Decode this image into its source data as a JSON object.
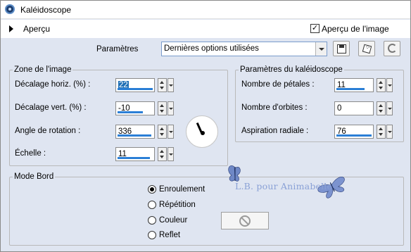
{
  "window": {
    "title": "Kaléidoscope"
  },
  "toolbar": {
    "apercu_label": "Aperçu",
    "preview_label": "Aperçu de l'image",
    "preview_checked": true,
    "params_label": "Paramètres",
    "preset_value": "Dernières options utilisées"
  },
  "zone": {
    "title": "Zone de l'image",
    "fields": [
      {
        "label": "Décalage horiz. (%) :",
        "value": "22"
      },
      {
        "label": "Décalage vert. (%) :",
        "value": "-10"
      },
      {
        "label": "Angle de rotation :",
        "value": "336"
      },
      {
        "label": "Échelle :",
        "value": "11"
      }
    ]
  },
  "kaleido": {
    "title": "Paramètres du kaléidoscope",
    "fields": [
      {
        "label": "Nombre de pétales :",
        "value": "11"
      },
      {
        "label": "Nombre d'orbites :",
        "value": "0"
      },
      {
        "label": "Aspiration radiale :",
        "value": "76"
      }
    ]
  },
  "mode": {
    "title": "Mode Bord",
    "options": [
      {
        "label": "Enroulement",
        "selected": true
      },
      {
        "label": "Répétition",
        "selected": false
      },
      {
        "label": "Couleur",
        "selected": false
      },
      {
        "label": "Reflet",
        "selected": false
      }
    ]
  },
  "watermark": {
    "text": "L.B. pour Animabelle"
  },
  "colors": {
    "dialog_bg": "#dfe5f1",
    "accent": "#2b7fd6",
    "selection": "#1f6fb5",
    "watermark": "#8aa1d6"
  }
}
